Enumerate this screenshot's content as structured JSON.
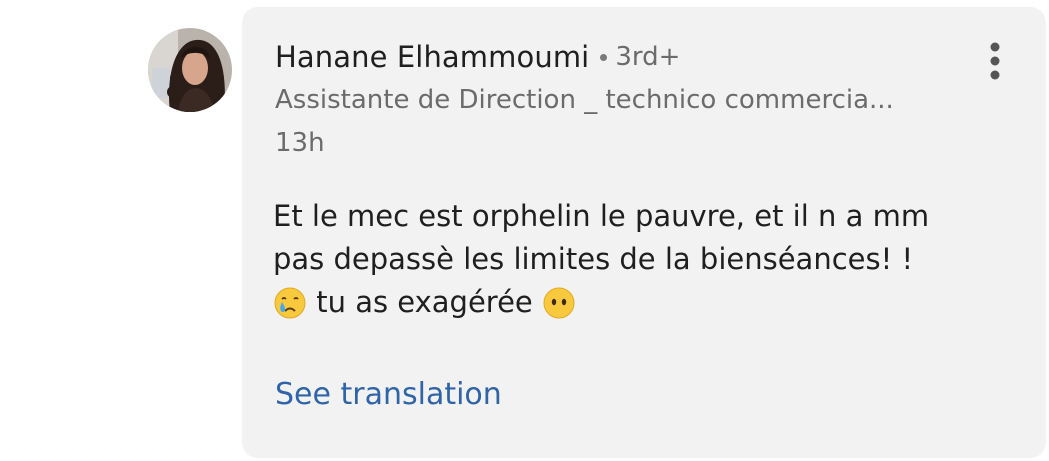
{
  "comment": {
    "author": {
      "name": "Hanane Elhammoumi",
      "degree": "3rd+",
      "headline": "Assistante de Direction _ technico commercia...",
      "avatar_icon": "profile-photo"
    },
    "time": "13h",
    "body": {
      "line1": "Et le mec est orphelin le pauvre, et il n a mm",
      "line2": "pas depassè les limites de la bienséances! !",
      "line3_text": "tu as exagérée",
      "emoji1": "crying-face",
      "emoji2": "face-without-mouth"
    },
    "see_translation": "See translation",
    "menu_icon": "more-vertical-icon"
  },
  "colors": {
    "bubble_bg": "#f2f2f2",
    "name": "#1f1f1f",
    "meta": "#6b6b6b",
    "link": "#2f64a8"
  }
}
